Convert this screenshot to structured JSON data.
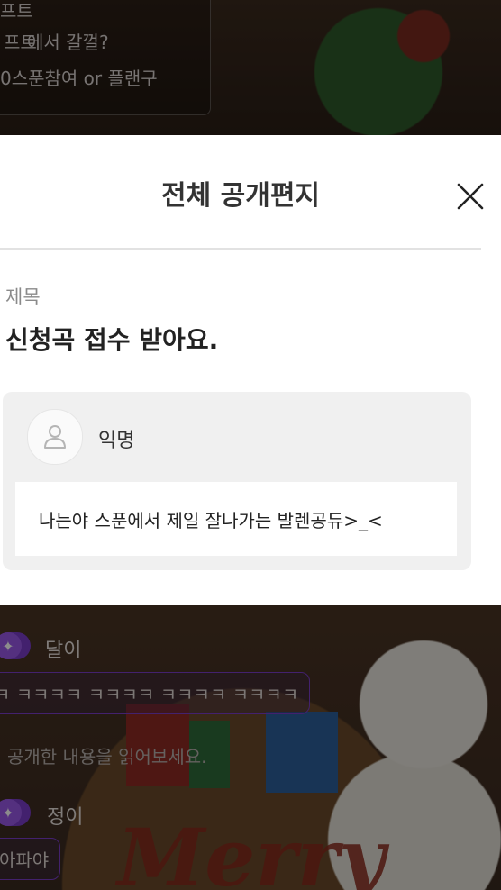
{
  "background": {
    "top_lines": [
      "프트",
      "프트",
      "에서 갈껄?",
      "0스푼참여 or 플랜구"
    ],
    "chat": [
      {
        "name": "달이",
        "message": "ㅋ ㅋㅋㅋㅋ ㅋㅋㅋㅋ ㅋㅋㅋㅋ ㅋㅋㅋㅋ"
      },
      {
        "system": "공개한 내용을 읽어보세요."
      },
      {
        "name": "정이",
        "message": "아파야"
      }
    ],
    "decor_text": "Merry"
  },
  "modal": {
    "title": "전체 공개편지",
    "subject_label": "제목",
    "subject": "신청곡 접수 받아요.",
    "author": "익명",
    "message": "나는야 스푼에서 제일 잘나가는 발렌공듀>_<"
  },
  "colors": {
    "accent_purple": "#7a3cc8",
    "modal_bg": "#ffffff",
    "card_bg": "#f0f0f0"
  },
  "icons": {
    "close": "close-icon",
    "avatar": "user-icon",
    "badge": "star-icon"
  }
}
